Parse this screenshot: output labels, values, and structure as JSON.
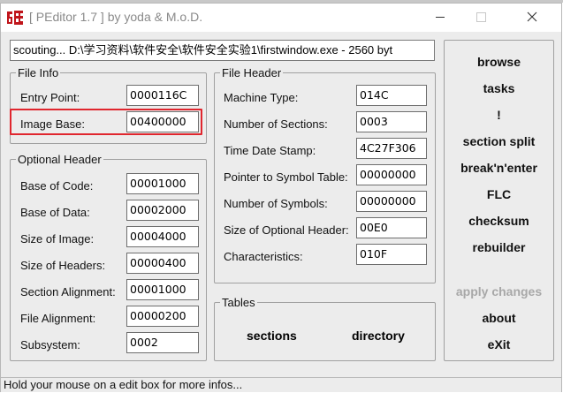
{
  "window": {
    "title": "[ PEditor 1.7 ]  by yoda & M.o.D."
  },
  "path": "scouting... D:\\学习资料\\软件安全\\软件安全实验1\\firstwindow.exe - 2560 byt",
  "file_info": {
    "legend": "File Info",
    "entry_point": {
      "label": "Entry Point:",
      "value": "0000116C"
    },
    "image_base": {
      "label": "Image Base:",
      "value": "00400000"
    }
  },
  "optional_header": {
    "legend": "Optional Header",
    "base_of_code": {
      "label": "Base of Code:",
      "value": "00001000"
    },
    "base_of_data": {
      "label": "Base of Data:",
      "value": "00002000"
    },
    "size_of_image": {
      "label": "Size of Image:",
      "value": "00004000"
    },
    "size_of_headers": {
      "label": "Size of Headers:",
      "value": "00000400"
    },
    "section_alignment": {
      "label": "Section Alignment:",
      "value": "00001000"
    },
    "file_alignment": {
      "label": "File Alignment:",
      "value": "00000200"
    },
    "subsystem": {
      "label": "Subsystem:",
      "value": "0002"
    }
  },
  "file_header": {
    "legend": "File Header",
    "machine_type": {
      "label": "Machine Type:",
      "value": "014C"
    },
    "number_of_sections": {
      "label": "Number of Sections:",
      "value": "0003"
    },
    "time_date_stamp": {
      "label": "Time Date Stamp:",
      "value": "4C27F306"
    },
    "pointer_to_symbol_table": {
      "label": "Pointer to Symbol Table:",
      "value": "00000000"
    },
    "number_of_symbols": {
      "label": "Number of Symbols:",
      "value": "00000000"
    },
    "size_of_optional_header": {
      "label": "Size of Optional Header:",
      "value": "00E0"
    },
    "characteristics": {
      "label": "Characteristics:",
      "value": "010F"
    }
  },
  "tables": {
    "legend": "Tables",
    "sections": "sections",
    "directory": "directory"
  },
  "menu": {
    "browse": "browse",
    "tasks": "tasks",
    "bang": "!",
    "section_split": "section split",
    "break_n_enter": "break'n'enter",
    "flc": "FLC",
    "checksum": "checksum",
    "rebuilder": "rebuilder",
    "apply_changes": "apply changes",
    "about": "about",
    "exit": "eXit"
  },
  "status": "Hold your mouse on a edit box for more infos...",
  "colors": {
    "highlight": "#e0262e",
    "window_bg": "#ececec",
    "disabled_text": "#a8a8a8"
  },
  "icons": {
    "app": "peditor-logo-icon",
    "minimize": "minimize-icon",
    "maximize": "maximize-icon",
    "close": "close-icon"
  }
}
